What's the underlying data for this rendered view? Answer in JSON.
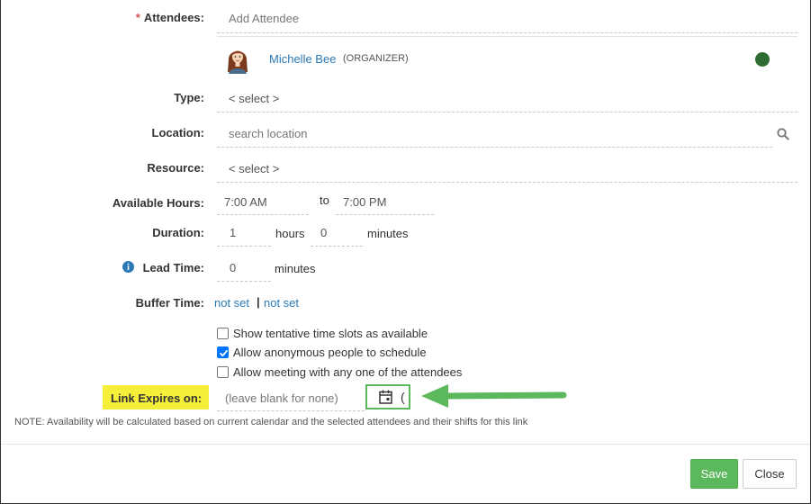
{
  "form": {
    "attendees": {
      "required_mark": "*",
      "label": "Attendees:",
      "placeholder": "Add Attendee",
      "list": [
        {
          "name": "Michelle Bee",
          "role": "(ORGANIZER)",
          "status_color": "#2e7d32"
        }
      ]
    },
    "type": {
      "label": "Type:",
      "value": "< select >"
    },
    "location": {
      "label": "Location:",
      "placeholder": "search location",
      "icon": "search-icon"
    },
    "resource": {
      "label": "Resource:",
      "value": "< select >"
    },
    "available_hours": {
      "label": "Available Hours:",
      "from": "7:00 AM",
      "to_label": "to",
      "to": "7:00 PM"
    },
    "duration": {
      "label": "Duration:",
      "hours_value": "1",
      "hours_label": "hours",
      "minutes_value": "0",
      "minutes_label": "minutes"
    },
    "lead_time": {
      "label": "Lead Time:",
      "value": "0",
      "unit": "minutes",
      "icon": "info-icon"
    },
    "buffer_time": {
      "label": "Buffer Time:",
      "before": "not set",
      "separator": "|",
      "after": "not set"
    },
    "options": [
      {
        "label": "Show tentative time slots as available",
        "checked": false
      },
      {
        "label": "Allow anonymous people to schedule",
        "checked": true
      },
      {
        "label": "Allow meeting with any one of the attendees",
        "checked": false
      }
    ],
    "link_expires": {
      "label": "Link Expires on:",
      "placeholder": "(leave blank for none)",
      "icon": "calendar-icon",
      "trailing": "(",
      "highlight_color": "#f5ef3a",
      "annotation_color": "#5cb85c"
    },
    "note": "NOTE: Availability will be calculated based on current calendar and the selected attendees and their shifts for this link"
  },
  "footer": {
    "save_label": "Save",
    "close_label": "Close",
    "save_color": "#5cb85c"
  }
}
